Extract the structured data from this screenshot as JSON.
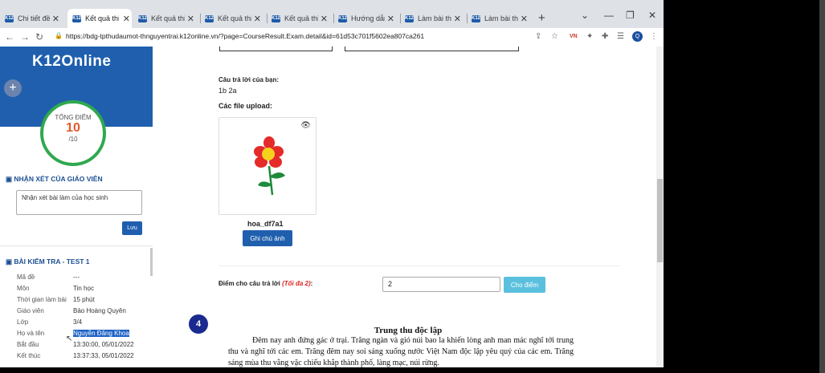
{
  "tabs": [
    {
      "title": "Chi tiết đề thi"
    },
    {
      "title": "Kết quả thi"
    },
    {
      "title": "Kết quả thi"
    },
    {
      "title": "Kết quả thi"
    },
    {
      "title": "Kết quả thi"
    },
    {
      "title": "Hướng dẫn s"
    },
    {
      "title": "Làm bài thi"
    },
    {
      "title": "Làm bài thi"
    }
  ],
  "browser": {
    "url": "https://bdg-tpthudaumot-thnguyentrai.k12online.vn/?page=CourseResult.Exam.detail&id=61d53c701f5602ea807ca261",
    "profile_initial": "Q",
    "tab_favicon_text": "K12",
    "ext_badge": "VN"
  },
  "sidebar": {
    "logo": "K12Online",
    "score_label": "TỔNG ĐIỂM",
    "score_value": "10",
    "score_max": "/10",
    "comment_heading": "NHẬN XÉT CỦA GIÁO VIÊN",
    "comment_placeholder": "Nhận xét bài làm của học sinh",
    "save_label": "Lưu",
    "exam_heading": "BÀI KIỂM TRA - TEST 1",
    "info": [
      {
        "key": "Mã đề",
        "value": "---"
      },
      {
        "key": "Môn",
        "value": "Tin học"
      },
      {
        "key": "Thời gian làm bài",
        "value": "15 phút"
      },
      {
        "key": "Giáo viên",
        "value": "Bảo Hoàng Quyên"
      },
      {
        "key": "Lớp",
        "value": "3/4"
      },
      {
        "key": "Họ và tên",
        "value": "Nguyễn Đăng Khoa"
      },
      {
        "key": "Bắt đầu",
        "value": "13:30:00, 05/01/2022"
      },
      {
        "key": "Kết thúc",
        "value": "13:37:33, 05/01/2022"
      }
    ]
  },
  "main": {
    "answer_label": "Câu trả lời của bạn:",
    "answer_value": "1b 2a",
    "upload_label": "Các file upload:",
    "file_name": "hoa_df7a1",
    "note_button": "Ghi chú ảnh",
    "score_label": "Điểm cho câu trả lời",
    "score_max_hint": "(Tối đa 2)",
    "score_colon": ":",
    "score_input_value": "2",
    "give_score_button": "Cho điểm",
    "question_number": "4",
    "passage_title": "Trung thu độc lập",
    "passage_text": "Đêm nay anh đứng gác ở trại. Trăng ngàn và gió núi bao la khiến lòng anh man mác nghĩ tới trung thu và nghĩ tới các em. Trăng đêm nay soi sáng xuống nước Việt Nam độc lập yêu quý của các em. Trăng sáng mùa thu vằng vặc chiếu khắp thành phố, làng mạc, núi rừng."
  },
  "colors": {
    "brand_blue": "#1f5fae",
    "score_ring": "#2fa84f",
    "score_number": "#e15b29",
    "give_score_button": "#5bc0de",
    "question_badge": "#1a2a8f"
  }
}
